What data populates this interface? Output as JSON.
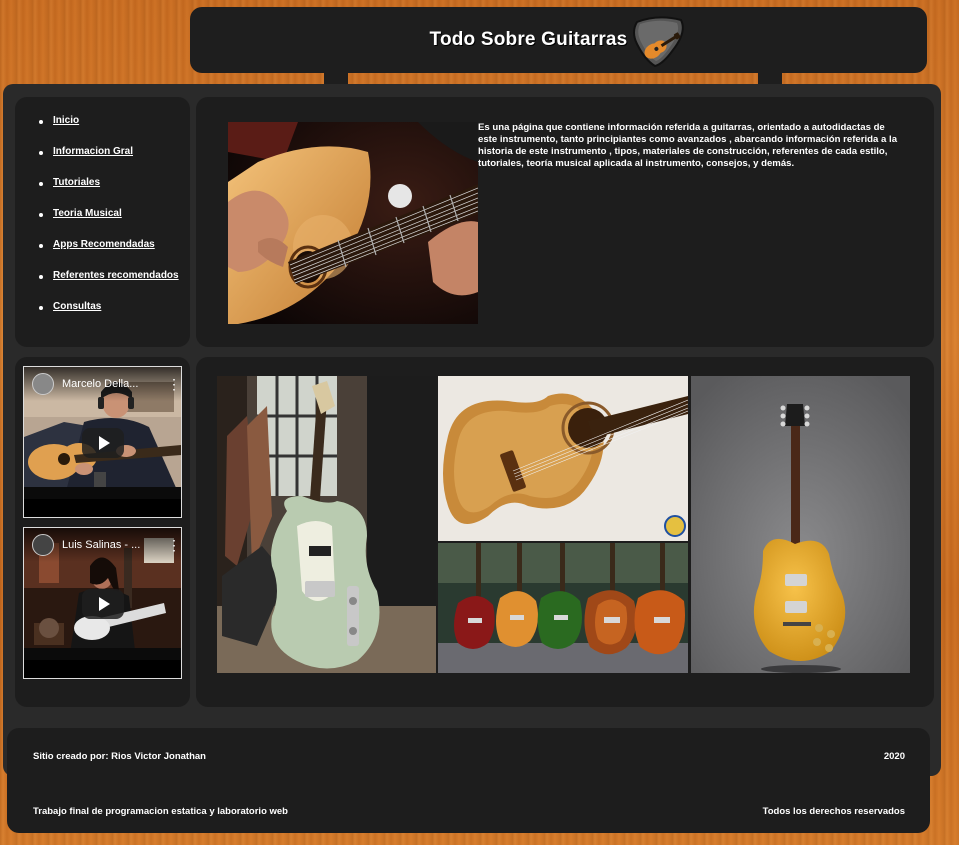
{
  "header": {
    "title": "Todo Sobre Guitarras",
    "logo_icon": "guitar-pick-icon"
  },
  "nav": {
    "items": [
      {
        "label": "Inicio"
      },
      {
        "label": "Informacion Gral"
      },
      {
        "label": "Tutoriales"
      },
      {
        "label": "Teoria Musical"
      },
      {
        "label": "Apps Recomendadas"
      },
      {
        "label": "Referentes recomendados"
      },
      {
        "label": "Consultas"
      }
    ]
  },
  "intro": {
    "image_icon": "acoustic-guitar-playing-photo",
    "text": "Es una página que contiene información referida a guitarras, orientado a autodidactas de este instrumento, tanto principiantes como avanzados , abarcando información referida a la historia de este instrumento , tipos, materiales de construcción, referentes de cada estilo, tutoriales, teoría musical aplicada al instrumento, consejos, y demás."
  },
  "videos": [
    {
      "title": "Marcelo Della..."
    },
    {
      "title": "Luis Salinas - ..."
    }
  ],
  "gallery": {
    "images": [
      {
        "name": "telecaster-electric-guitar-photo"
      },
      {
        "name": "classical-acoustic-guitar-photo"
      },
      {
        "name": "les-paul-guitars-row-photo"
      },
      {
        "name": "les-paul-gold-top-photo"
      }
    ]
  },
  "footer": {
    "credit": "Sitio creado por: Rios Victor Jonathan",
    "year": "2020",
    "project": "Trabajo final de programacion estatica y laboratorio web",
    "rights": "Todos los derechos reservados"
  },
  "colors": {
    "background_wood": "#cf7426",
    "panel": "#1d1d1d",
    "frame": "#2a2a2a",
    "text": "#ffffff"
  }
}
